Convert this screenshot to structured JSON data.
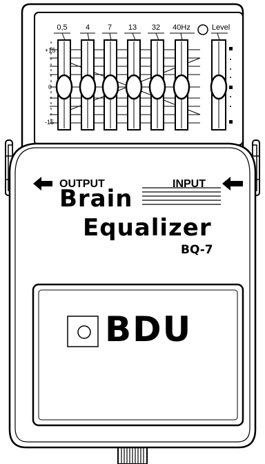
{
  "eq": {
    "bands": [
      {
        "label": "0,5"
      },
      {
        "label": "4"
      },
      {
        "label": "7"
      },
      {
        "label": "13"
      },
      {
        "label": "32"
      },
      {
        "label": "40Hz"
      }
    ],
    "level_label": "Level",
    "scale": {
      "top": "+15",
      "mid": "0",
      "bottom": "-15"
    }
  },
  "jacks": {
    "output_label": "OUTPUT",
    "input_label": "INPUT"
  },
  "brand": {
    "line1": "Brain",
    "line2": "Equalizer",
    "model": "BQ-7"
  },
  "footswitch": {
    "logo_text": "BDU"
  },
  "colors": {
    "ink": "#000000",
    "body": "#ffffff"
  }
}
